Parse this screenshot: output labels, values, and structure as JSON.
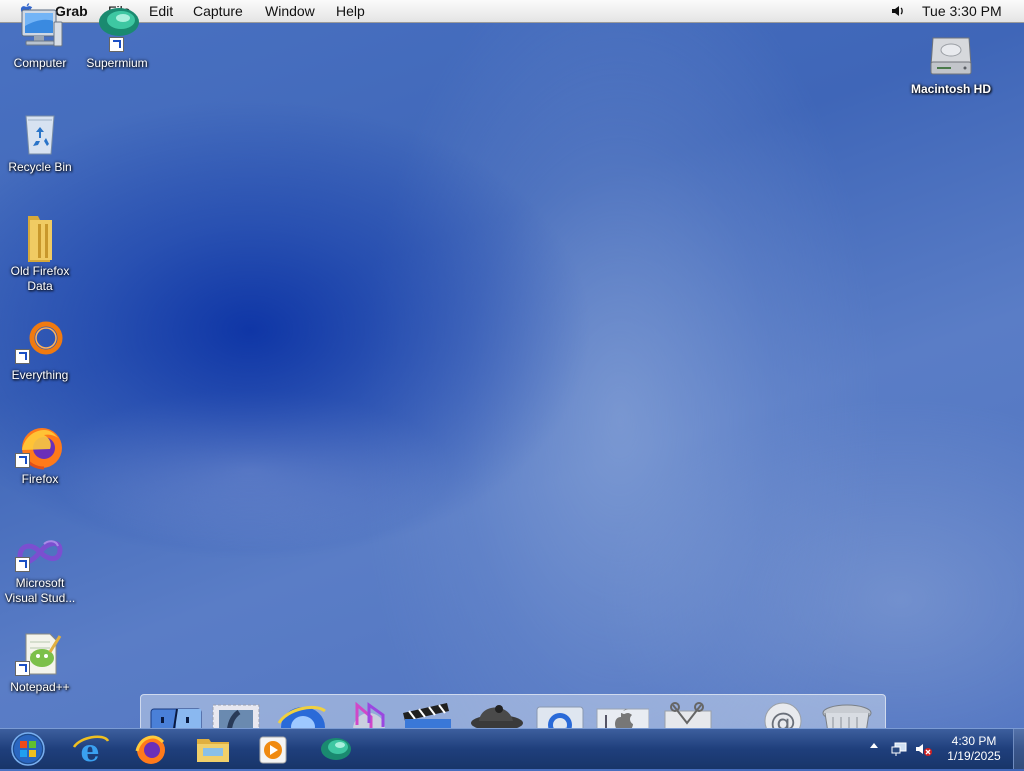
{
  "menubar": {
    "app_name": "Grab",
    "menus": [
      "File",
      "Edit",
      "Capture",
      "Window",
      "Help"
    ],
    "clock": "Tue 3:30 PM"
  },
  "desktop_icons": [
    {
      "label": "Computer",
      "icon": "computer-icon"
    },
    {
      "label": "Supermium",
      "icon": "supermium-icon"
    },
    {
      "label": "Recycle Bin",
      "icon": "recycle-bin-icon"
    },
    {
      "label": "Old Firefox Data",
      "icon": "folder-icon"
    },
    {
      "label": "Everything",
      "icon": "everything-search-icon"
    },
    {
      "label": "Firefox",
      "icon": "firefox-icon"
    },
    {
      "label": "Microsoft Visual Stud...",
      "icon": "visual-studio-icon"
    },
    {
      "label": "Notepad++",
      "icon": "notepad-plus-plus-icon"
    },
    {
      "label": "Macintosh HD",
      "icon": "hard-drive-icon"
    }
  ],
  "dock_items": [
    "finder",
    "mail-stamp",
    "internet-explorer",
    "itunes",
    "imovie",
    "sherlock",
    "quicktime",
    "system-preferences",
    "grab",
    "mail",
    "trash"
  ],
  "taskbar": {
    "items": [
      "start-orb",
      "internet-explorer",
      "firefox",
      "file-explorer",
      "media-player",
      "supermium"
    ],
    "time": "4:30 PM",
    "date": "1/19/2025"
  }
}
